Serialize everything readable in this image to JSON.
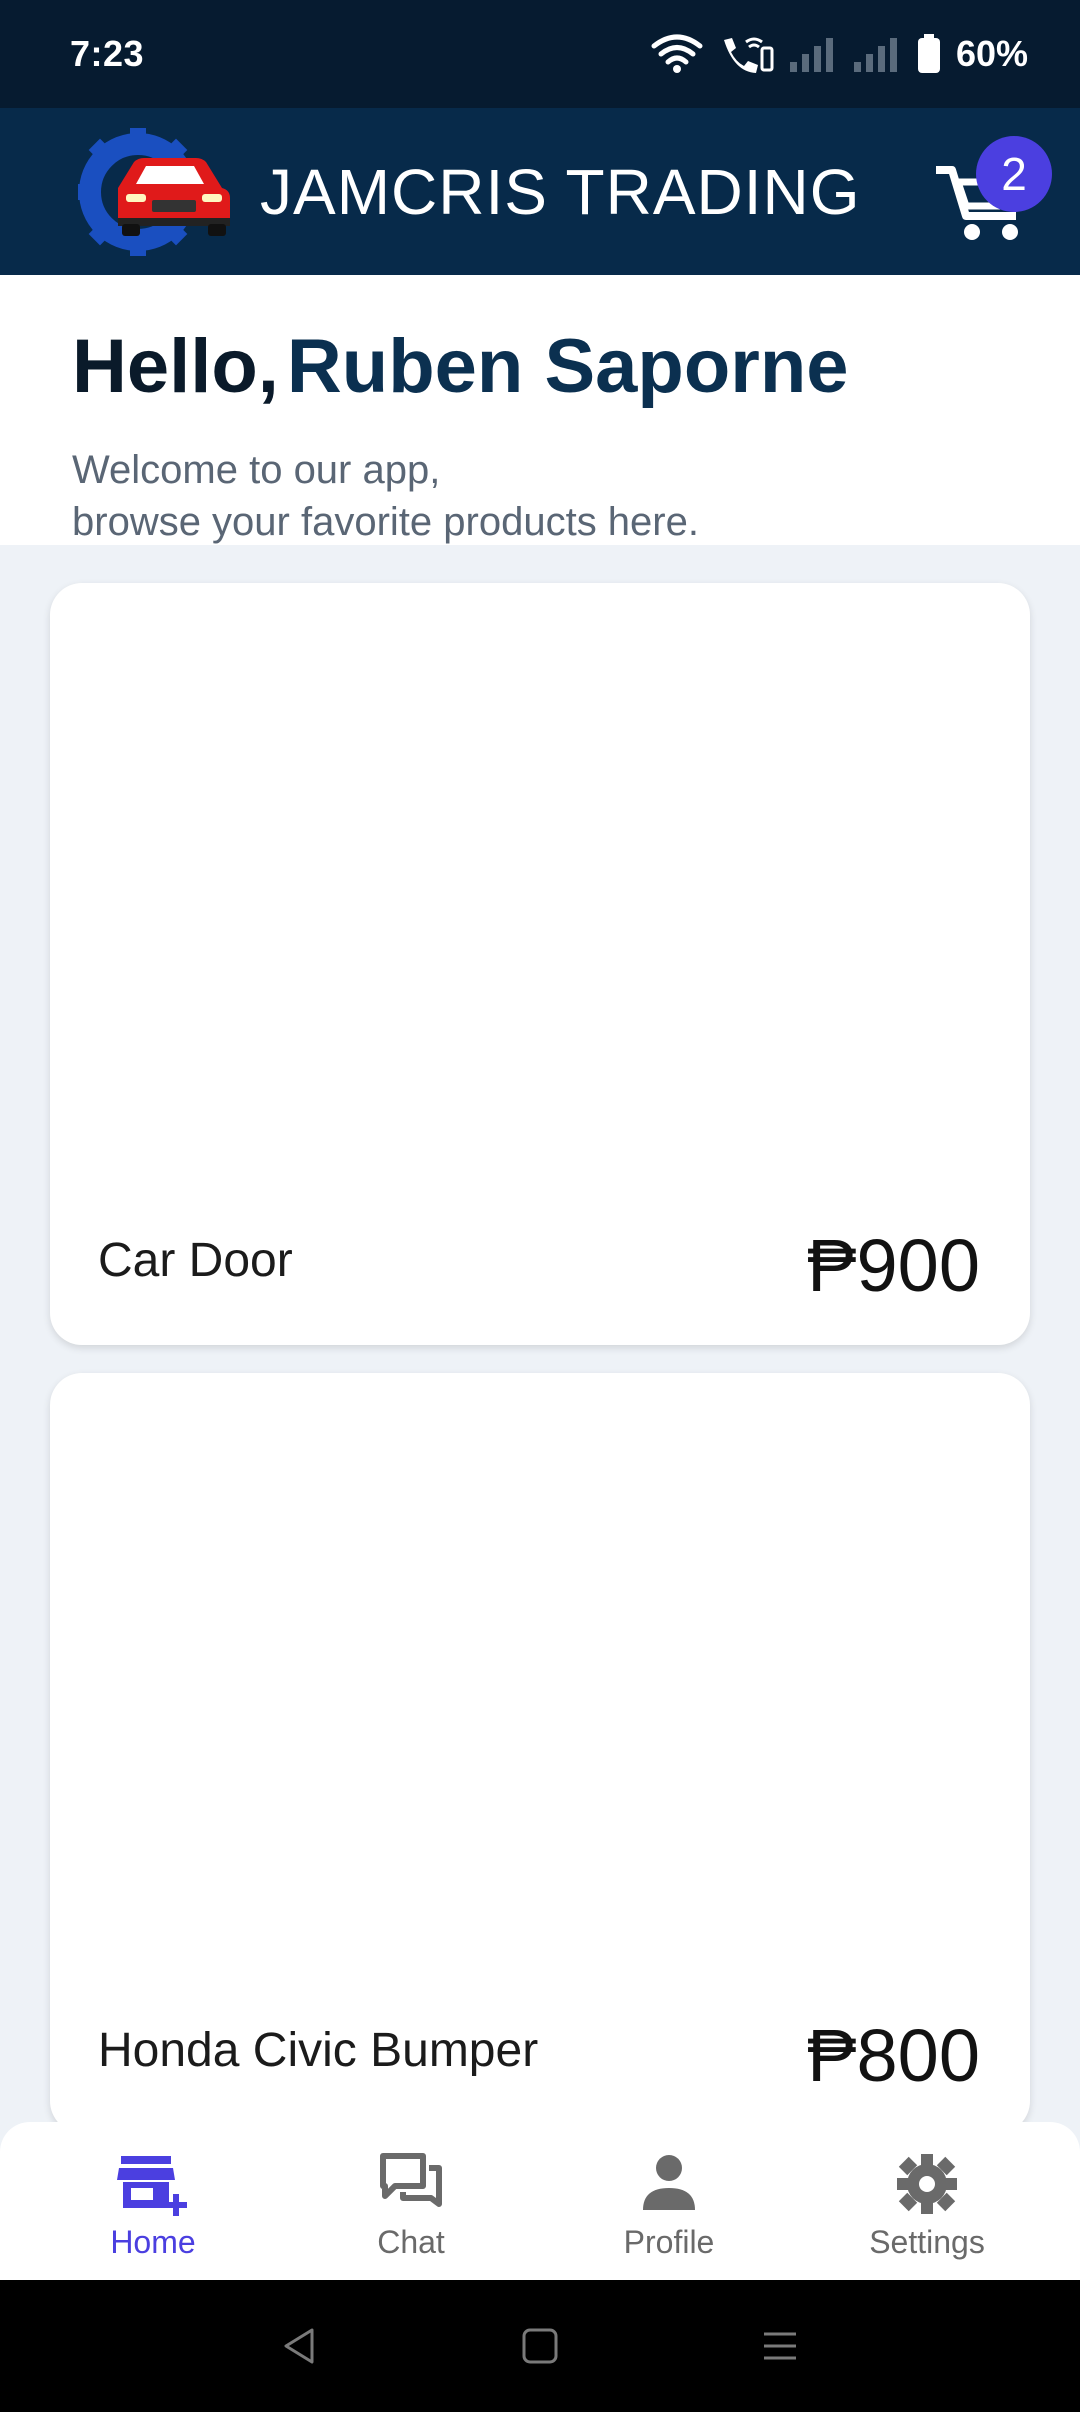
{
  "status_bar": {
    "time": "7:23",
    "battery": "60%"
  },
  "app_bar": {
    "title": "JAMCRIS TRADING",
    "cart_count": "2"
  },
  "greeting": {
    "hello": "Hello,",
    "name": "Ruben Saporne",
    "welcome_line1": "Welcome to our app,",
    "welcome_line2": "browse your favorite products here."
  },
  "products": [
    {
      "name": "Car Door",
      "price": "₱900"
    },
    {
      "name": "Honda Civic Bumper",
      "price": "₱800"
    }
  ],
  "bottom_nav": [
    {
      "label": "Home",
      "icon": "store-add-icon",
      "active": true
    },
    {
      "label": "Chat",
      "icon": "chat-icon",
      "active": false
    },
    {
      "label": "Profile",
      "icon": "person-icon",
      "active": false
    },
    {
      "label": "Settings",
      "icon": "gear-icon",
      "active": false
    }
  ],
  "colors": {
    "status_bar_bg": "#061b30",
    "app_bar_bg": "#072a4a",
    "accent": "#4b3fe0",
    "logo_gear": "#1a4fc0",
    "logo_car": "#e01a1a"
  }
}
